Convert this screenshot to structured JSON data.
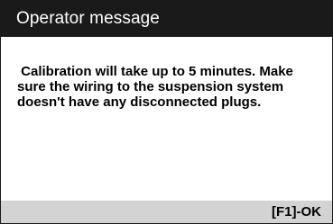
{
  "dialog": {
    "title": "Operator message",
    "message": " Calibration will take up to 5 minutes. Make\nsure the wiring to the suspension system\ndoesn't have any disconnected plugs."
  },
  "footer": {
    "ok_label": "[F1]-OK"
  },
  "colors": {
    "titlebar_bg": "#1a1a1a",
    "titlebar_text": "#ffffff",
    "footer_bg": "#d3d3d3",
    "body_bg": "#ffffff"
  }
}
